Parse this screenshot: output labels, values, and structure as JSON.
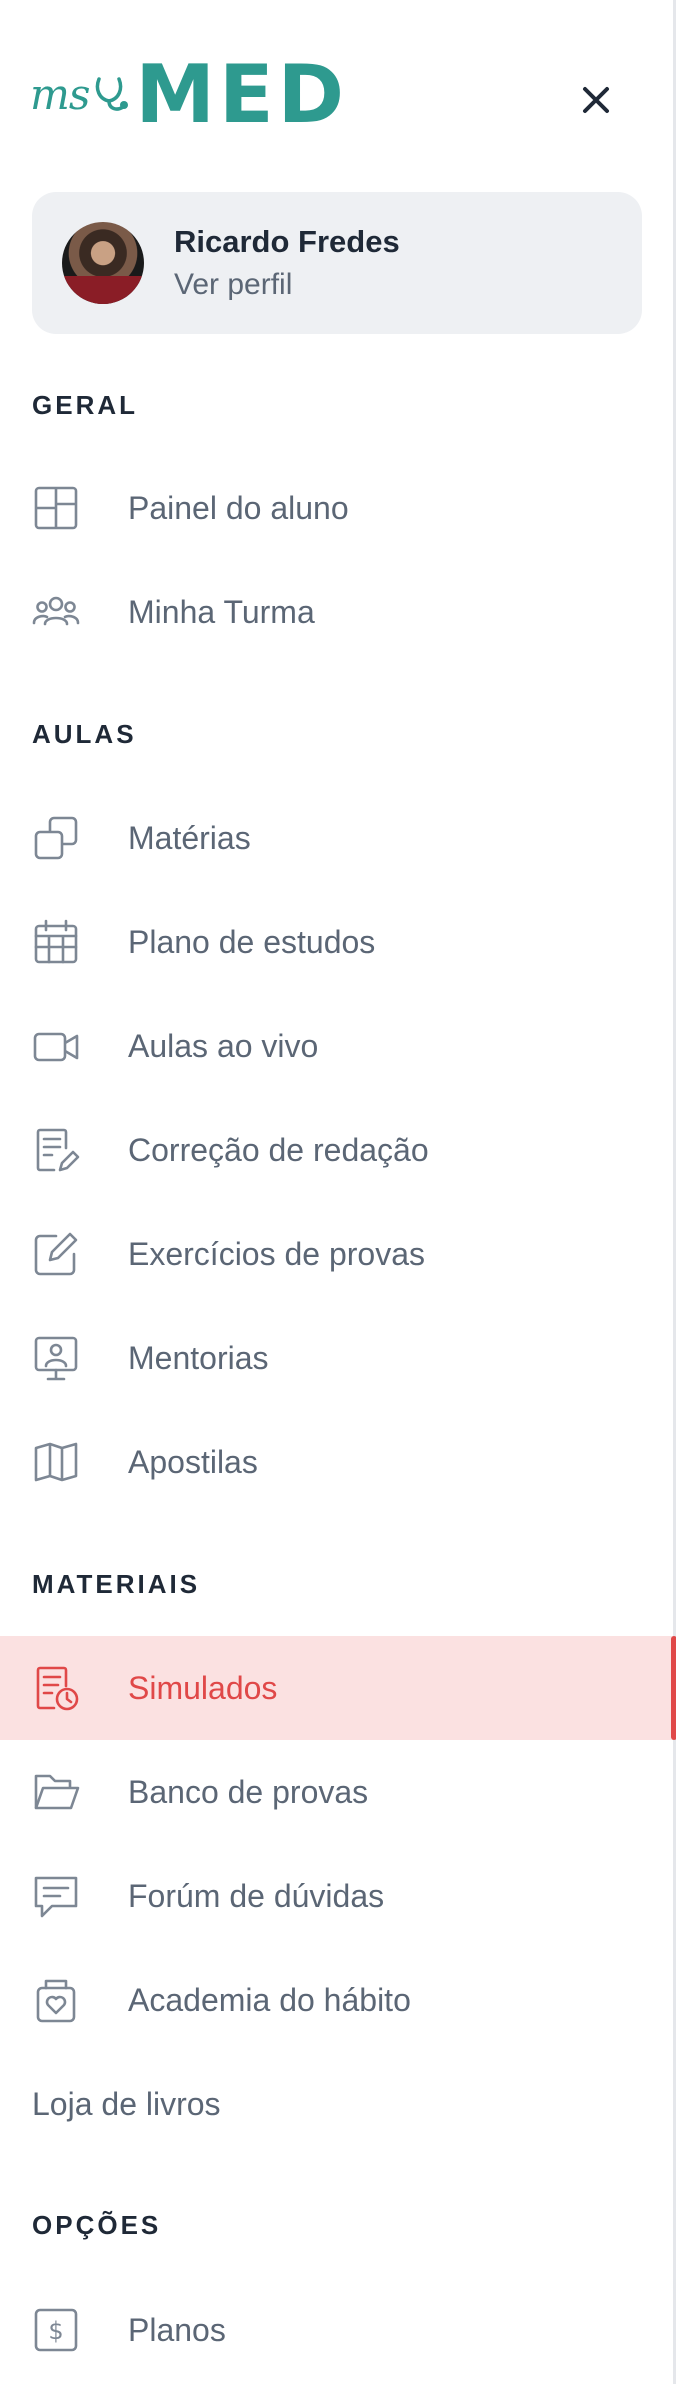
{
  "brand": {
    "logo_prefix": "ms",
    "logo_word": "MED",
    "accent_color": "#2e9a8f"
  },
  "header": {
    "close_icon": "close-icon"
  },
  "profile": {
    "name": "Ricardo Fredes",
    "link_label": "Ver perfil"
  },
  "sections": {
    "geral": "GERAL",
    "aulas": "AULAS",
    "materiais": "MATERIAIS",
    "opcoes": "OPÇÕES"
  },
  "nav": {
    "painel": {
      "label": "Painel do aluno",
      "icon": "dashboard-layout-icon"
    },
    "turma": {
      "label": "Minha Turma",
      "icon": "users-group-icon"
    },
    "materias": {
      "label": "Matérias",
      "icon": "stacked-squares-icon"
    },
    "plano": {
      "label": "Plano de estudos",
      "icon": "calendar-icon"
    },
    "aulas_vivo": {
      "label": "Aulas ao vivo",
      "icon": "video-camera-icon"
    },
    "redacao": {
      "label": "Correção de redação",
      "icon": "document-edit-icon"
    },
    "exercicios": {
      "label": "Exercícios de provas",
      "icon": "pencil-square-icon"
    },
    "mentorias": {
      "label": "Mentorias",
      "icon": "presentation-user-icon"
    },
    "apostilas": {
      "label": "Apostilas",
      "icon": "open-book-icon"
    },
    "simulados": {
      "label": "Simulados",
      "icon": "document-clock-icon",
      "active": true
    },
    "banco": {
      "label": "Banco de provas",
      "icon": "folder-open-icon"
    },
    "forum": {
      "label": "Forúm de dúvidas",
      "icon": "chat-message-icon"
    },
    "academia": {
      "label": "Academia do hábito",
      "icon": "heart-box-icon"
    },
    "loja": {
      "label": "Loja de livros"
    },
    "planos": {
      "label": "Planos",
      "icon": "dollar-badge-icon"
    }
  },
  "colors": {
    "active_bg": "#fbe1e1",
    "active_text": "#e04848",
    "muted_text": "#5b6675",
    "icon_stroke": "#7d8794"
  }
}
